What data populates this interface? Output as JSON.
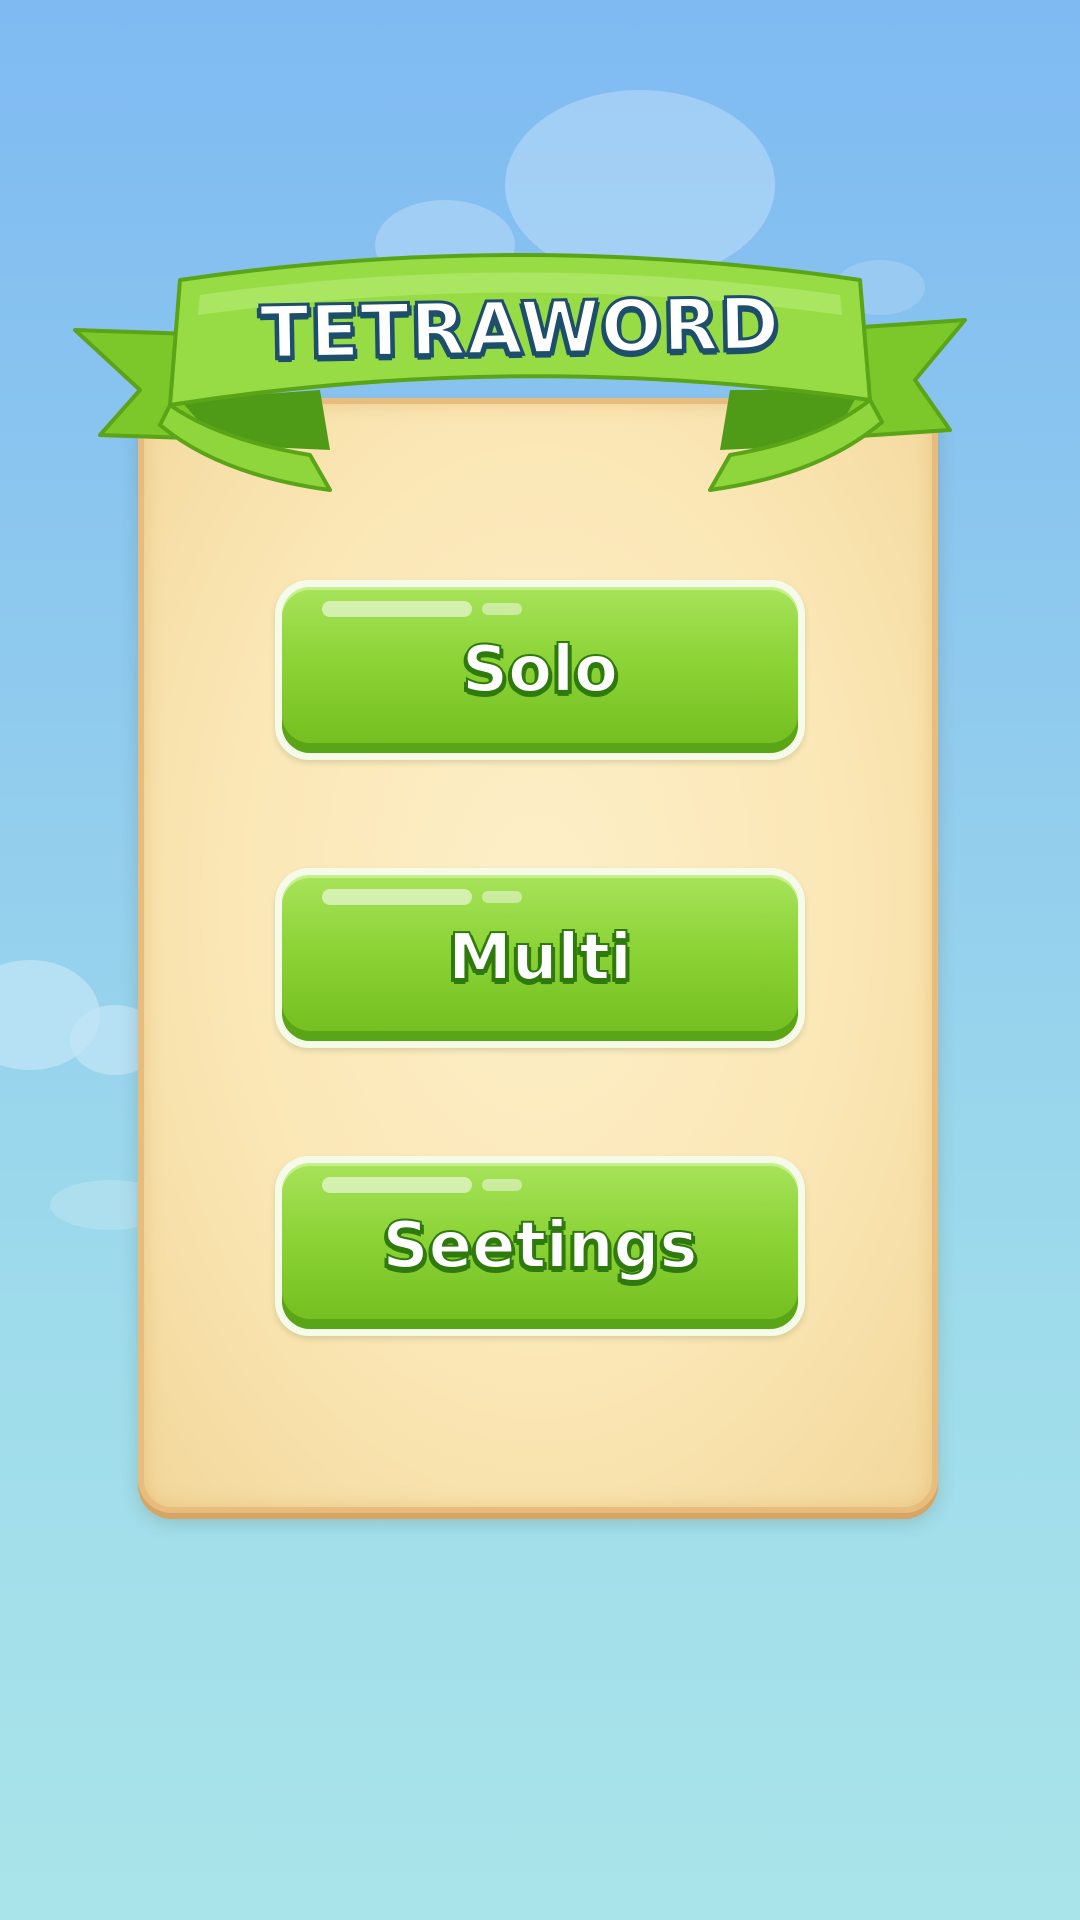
{
  "game": {
    "title": "TETRAWORD"
  },
  "menu": {
    "buttons": [
      {
        "id": "solo",
        "label": "Solo"
      },
      {
        "id": "multi",
        "label": "Multi"
      },
      {
        "id": "settings",
        "label": "Seetings"
      }
    ]
  },
  "colors": {
    "sky_top": "#7fbaf2",
    "sky_bottom": "#a9e4ea",
    "ribbon_green": "#8fd63c",
    "button_green": "#8cd336",
    "board_parchment": "#fbe7b6",
    "title_outline": "#1d4f6c"
  }
}
